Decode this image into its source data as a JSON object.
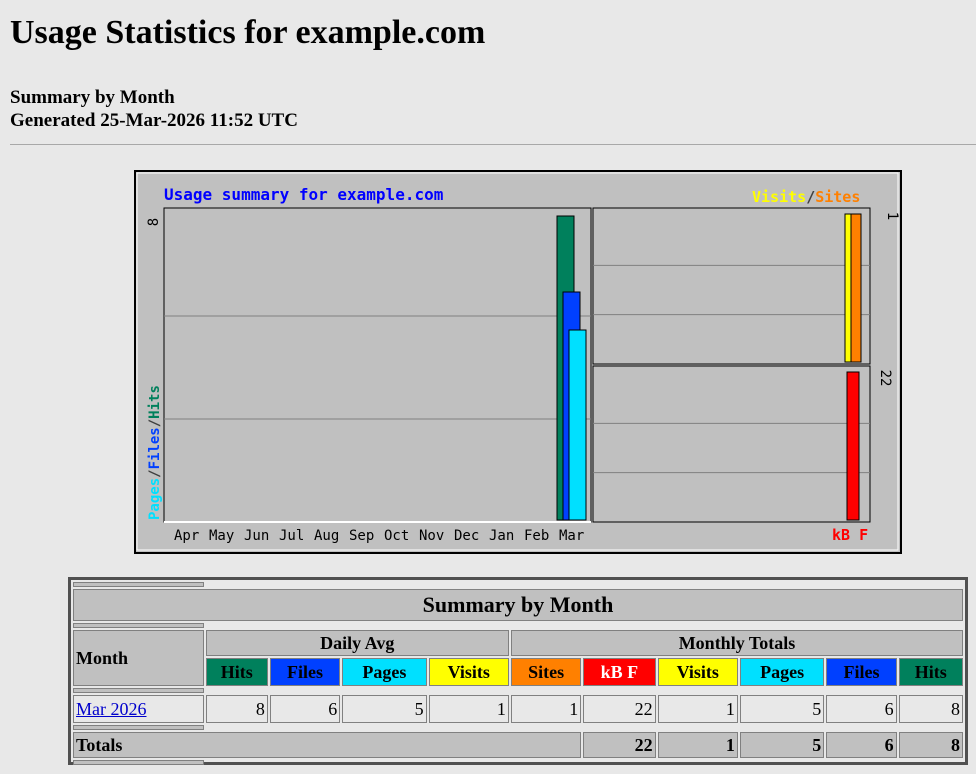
{
  "page": {
    "title": "Usage Statistics for example.com",
    "subtitle": "Summary by Month",
    "generated": "Generated 25-Mar-2026 11:52 UTC"
  },
  "colors": {
    "hits": "#00805c",
    "files": "#0040ff",
    "pages": "#00e0ff",
    "visits": "#ffff00",
    "sites": "#ff8000",
    "kbf": "#ff0000",
    "title": "#0000ff"
  },
  "chart_data": {
    "type": "bar",
    "title": "Usage summary for example.com",
    "categories": [
      "Apr",
      "May",
      "Jun",
      "Jul",
      "Aug",
      "Sep",
      "Oct",
      "Nov",
      "Dec",
      "Jan",
      "Feb",
      "Mar"
    ],
    "left_panel": {
      "axis_label_parts": [
        "Pages",
        "Files",
        "Hits"
      ],
      "axis_max_label": "8",
      "ylim": [
        0,
        8
      ],
      "series": [
        {
          "name": "Hits",
          "values": [
            0,
            0,
            0,
            0,
            0,
            0,
            0,
            0,
            0,
            0,
            0,
            8
          ]
        },
        {
          "name": "Files",
          "values": [
            0,
            0,
            0,
            0,
            0,
            0,
            0,
            0,
            0,
            0,
            0,
            6
          ]
        },
        {
          "name": "Pages",
          "values": [
            0,
            0,
            0,
            0,
            0,
            0,
            0,
            0,
            0,
            0,
            0,
            5
          ]
        }
      ]
    },
    "right_top_panel": {
      "legend_parts": [
        "Visits",
        "Sites"
      ],
      "axis_max_label": "1",
      "ylim": [
        0,
        1
      ],
      "series": [
        {
          "name": "Visits",
          "values": [
            1
          ]
        },
        {
          "name": "Sites",
          "values": [
            1
          ]
        }
      ]
    },
    "right_bottom_panel": {
      "legend": "kB F",
      "axis_max_label": "22",
      "ylim": [
        0,
        22
      ],
      "series": [
        {
          "name": "kB F",
          "values": [
            22
          ]
        }
      ]
    },
    "grid": true
  },
  "table": {
    "title": "Summary by Month",
    "month_header": "Month",
    "daily_avg_header": "Daily Avg",
    "monthly_totals_header": "Monthly Totals",
    "daily_cols": [
      "Hits",
      "Files",
      "Pages",
      "Visits"
    ],
    "monthly_cols": [
      "Sites",
      "kB F",
      "Visits",
      "Pages",
      "Files",
      "Hits"
    ],
    "rows": [
      {
        "month": "Mar 2026",
        "daily": [
          "8",
          "6",
          "5",
          "1"
        ],
        "monthly": [
          "1",
          "22",
          "1",
          "5",
          "6",
          "8"
        ]
      }
    ],
    "totals_label": "Totals",
    "totals": [
      "22",
      "1",
      "5",
      "6",
      "8"
    ]
  }
}
